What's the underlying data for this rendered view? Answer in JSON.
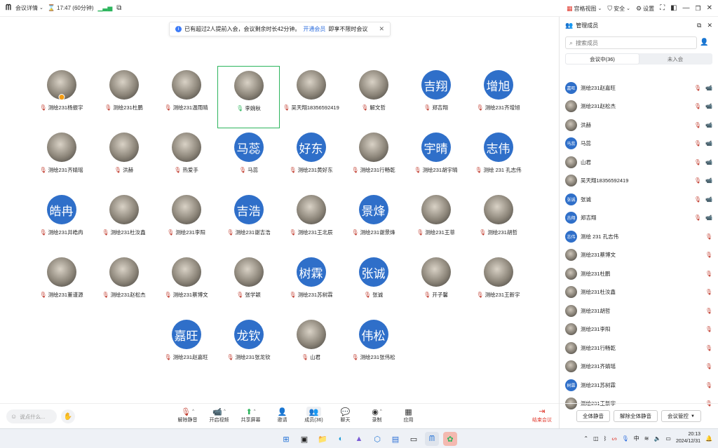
{
  "topbar": {
    "app_label": "会议详情",
    "timer": "17:47 (60分钟)",
    "view_label": "宫格视图",
    "security_label": "安全",
    "settings_label": "设置"
  },
  "notice": {
    "text_before": "已有超过2人提前入会，会议剩余时长42分钟。",
    "link": "开通会员",
    "text_after": "即享不限时会议"
  },
  "tiles": [
    {
      "name": "测绘231杨振宇",
      "kind": "img",
      "mic": "off",
      "host": true
    },
    {
      "name": "测绘231杜鹏",
      "kind": "img",
      "mic": "off"
    },
    {
      "name": "测绘231温雨晴",
      "kind": "img",
      "mic": "off"
    },
    {
      "name": "李婉秋",
      "kind": "img",
      "mic": "on",
      "active": true
    },
    {
      "name": "吴天翔18356592419",
      "kind": "img",
      "mic": "off"
    },
    {
      "name": "解文哲",
      "kind": "img",
      "mic": "off"
    },
    {
      "name": "郑吉翔",
      "kind": "txt",
      "avatar": "吉翔",
      "mic": "off"
    },
    {
      "name": "测绘231齐增旭",
      "kind": "txt",
      "avatar": "增旭",
      "mic": "off"
    },
    {
      "name": "测绘231齐婧瑶",
      "kind": "img",
      "mic": "off"
    },
    {
      "name": "洪赫",
      "kind": "img",
      "mic": "off"
    },
    {
      "name": "热爱手",
      "kind": "img",
      "mic": "off"
    },
    {
      "name": "马蕊",
      "kind": "txt",
      "avatar": "马蕊",
      "mic": "off"
    },
    {
      "name": "测绘231黄好东",
      "kind": "txt",
      "avatar": "好东",
      "mic": "off"
    },
    {
      "name": "测绘231行畅乾",
      "kind": "img",
      "mic": "off"
    },
    {
      "name": "测绘231胡宇晴",
      "kind": "txt",
      "avatar": "宇晴",
      "mic": "off"
    },
    {
      "name": "测绘 231 孔志伟",
      "kind": "txt",
      "avatar": "志伟",
      "mic": "off"
    },
    {
      "name": "测绘231井皓冉",
      "kind": "txt",
      "avatar": "皓冉",
      "mic": "off"
    },
    {
      "name": "测绘231杜汝鑫",
      "kind": "img",
      "mic": "off"
    },
    {
      "name": "测绘231李阳",
      "kind": "img",
      "mic": "off"
    },
    {
      "name": "测绘231谢吉浩",
      "kind": "txt",
      "avatar": "吉浩",
      "mic": "off"
    },
    {
      "name": "测绘231王北辰",
      "kind": "img",
      "mic": "off"
    },
    {
      "name": "测绘231谢景烽",
      "kind": "txt",
      "avatar": "景烽",
      "mic": "off"
    },
    {
      "name": "测绘231王菲",
      "kind": "img",
      "mic": "off"
    },
    {
      "name": "测绘231胡哲",
      "kind": "img",
      "mic": "off"
    },
    {
      "name": "测绘231董谨源",
      "kind": "img",
      "mic": "off"
    },
    {
      "name": "测绘231赵松杰",
      "kind": "img",
      "mic": "off"
    },
    {
      "name": "测绘231蔡博文",
      "kind": "img",
      "mic": "off"
    },
    {
      "name": "张学颖",
      "kind": "img",
      "mic": "off"
    },
    {
      "name": "测绘231苏树霖",
      "kind": "txt",
      "avatar": "树霖",
      "mic": "off"
    },
    {
      "name": "张诚",
      "kind": "txt",
      "avatar": "张诚",
      "mic": "off"
    },
    {
      "name": "开子馨",
      "kind": "img",
      "mic": "off"
    },
    {
      "name": "测绘231王新宇",
      "kind": "img",
      "mic": "off"
    },
    {
      "name": "测绘231赵嘉旺",
      "kind": "txt",
      "avatar": "嘉旺",
      "mic": "off",
      "col": 3
    },
    {
      "name": "测绘231张龙钦",
      "kind": "txt",
      "avatar": "龙钦",
      "mic": "off"
    },
    {
      "name": "山君",
      "kind": "img",
      "mic": "off"
    },
    {
      "name": "测绘231张伟松",
      "kind": "txt",
      "avatar": "伟松",
      "mic": "off"
    }
  ],
  "panel": {
    "title": "管理成员",
    "search_placeholder": "搜索成员",
    "tab_in": "会议中(36)",
    "tab_out": "未入会",
    "members": [
      {
        "name": "测绘231赵嘉旺",
        "kind": "txt",
        "avatar": "嘉旺",
        "cam": true
      },
      {
        "name": "测绘231赵松杰",
        "kind": "img",
        "cam": true
      },
      {
        "name": "洪赫",
        "kind": "img",
        "cam": true
      },
      {
        "name": "马蕊",
        "kind": "txt",
        "avatar": "马蕊",
        "cam": true
      },
      {
        "name": "山君",
        "kind": "img",
        "cam": true
      },
      {
        "name": "吴天翔18356592419",
        "kind": "img",
        "cam": true
      },
      {
        "name": "张诚",
        "kind": "txt",
        "avatar": "张诚",
        "cam": true
      },
      {
        "name": "郑吉翔",
        "kind": "txt",
        "avatar": "吉翔",
        "cam": true
      },
      {
        "name": "测绘 231 孔志伟",
        "kind": "txt",
        "avatar": "志伟",
        "cam": false
      },
      {
        "name": "测绘231蔡博文",
        "kind": "img",
        "cam": false
      },
      {
        "name": "测绘231杜鹏",
        "kind": "img",
        "cam": false
      },
      {
        "name": "测绘231杜汝鑫",
        "kind": "img",
        "cam": false
      },
      {
        "name": "测绘231胡哲",
        "kind": "img",
        "cam": false
      },
      {
        "name": "测绘231李阳",
        "kind": "img",
        "cam": false
      },
      {
        "name": "测绘231行畅乾",
        "kind": "img",
        "cam": false
      },
      {
        "name": "测绘231齐婧瑶",
        "kind": "img",
        "cam": false
      },
      {
        "name": "测绘231苏树霖",
        "kind": "txt",
        "avatar": "树霖",
        "cam": false
      },
      {
        "name": "测绘231王新宇",
        "kind": "img",
        "cam": false
      }
    ],
    "btn_mute_all": "全体静音",
    "btn_unmute_all": "解除全体静音",
    "btn_control": "会议管控"
  },
  "toolbar": {
    "chat_placeholder": "说点什么...",
    "unmute": "解除静音",
    "start_video": "开启视频",
    "share": "共享屏幕",
    "invite": "邀请",
    "members": "成员(36)",
    "chat": "聊天",
    "record": "录制",
    "apps": "应用",
    "end": "结束会议"
  },
  "taskbar": {
    "time": "20:13",
    "date": "2024/12/31"
  }
}
